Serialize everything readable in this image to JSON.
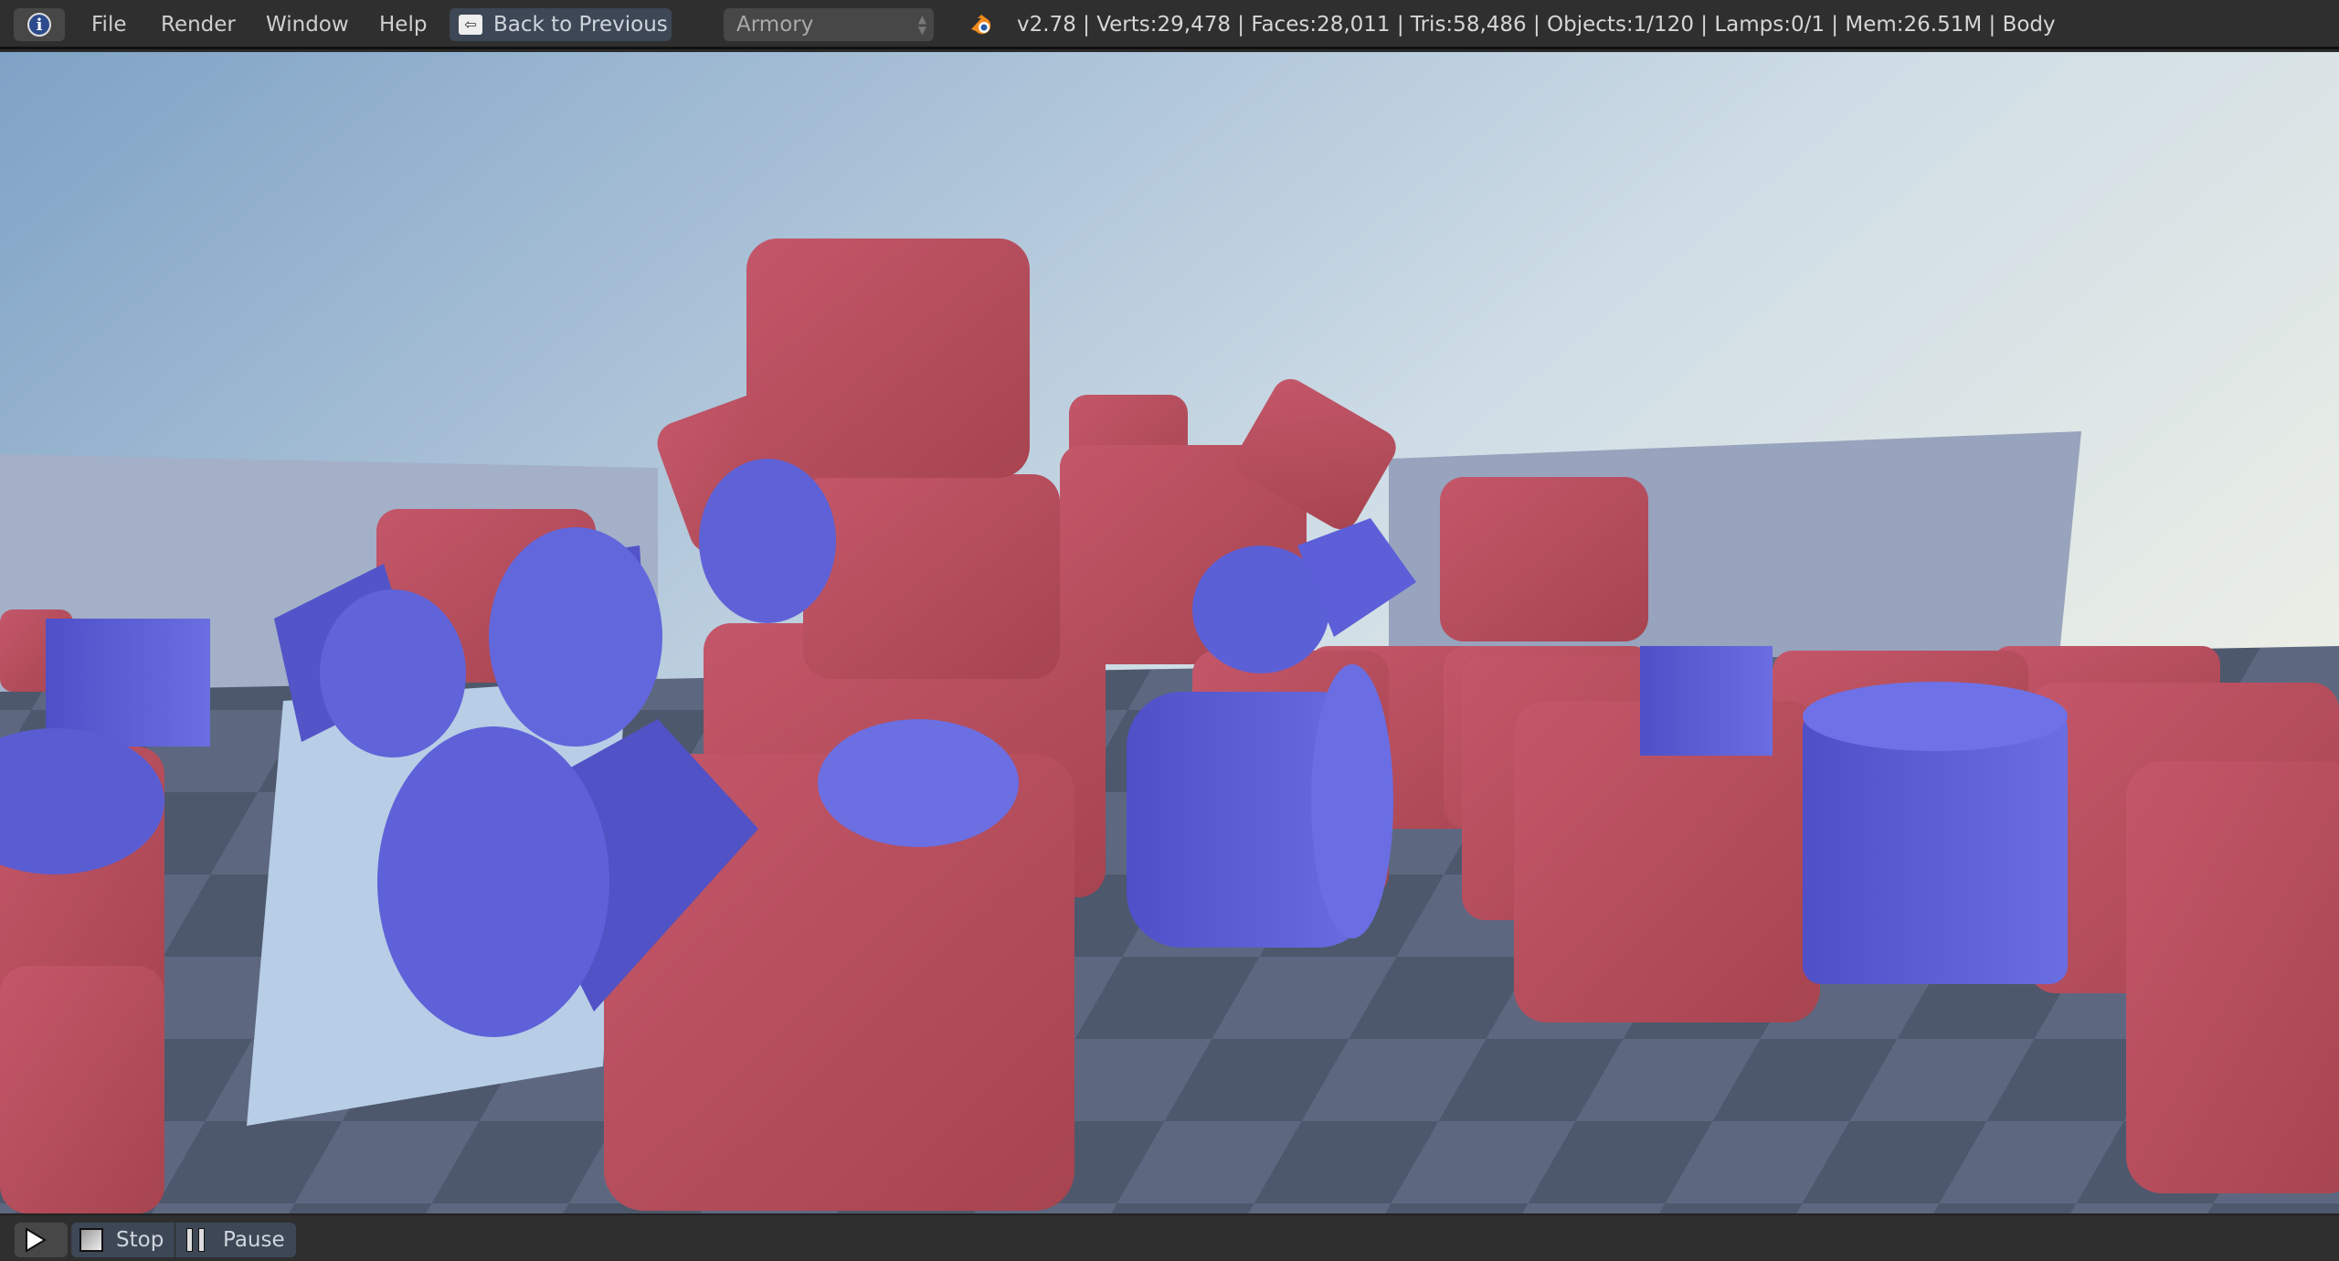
{
  "topbar": {
    "info_icon": "info-icon",
    "menus": [
      "File",
      "Render",
      "Window",
      "Help"
    ],
    "back_label": "Back to Previous",
    "render_engine": "Armory",
    "stats": "v2.78 | Verts:29,478 | Faces:28,011 | Tris:58,486 | Objects:1/120 | Lamps:0/1 | Mem:26.51M | Body"
  },
  "bottombar": {
    "play_icon": "play-icon",
    "stop_label": "Stop",
    "pause_label": "Pause"
  },
  "colors": {
    "cube": "#b84f60",
    "cylinder": "#5c5fd6",
    "floor": "#4b5569",
    "sky": "#9fbcd6"
  }
}
